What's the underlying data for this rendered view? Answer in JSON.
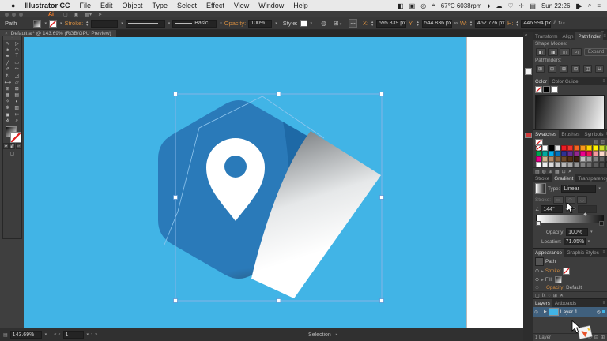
{
  "menubar": {
    "apple": "●",
    "app_name": "Illustrator CC",
    "items": [
      {
        "label": "File",
        "name": "menu-file"
      },
      {
        "label": "Edit",
        "name": "menu-edit"
      },
      {
        "label": "Object",
        "name": "menu-object"
      },
      {
        "label": "Type",
        "name": "menu-type"
      },
      {
        "label": "Select",
        "name": "menu-select"
      },
      {
        "label": "Effect",
        "name": "menu-effect"
      },
      {
        "label": "View",
        "name": "menu-view"
      },
      {
        "label": "Window",
        "name": "menu-window"
      },
      {
        "label": "Help",
        "name": "menu-help"
      }
    ],
    "status_icons": [
      {
        "glyph": "◧",
        "name": "shield-icon"
      },
      {
        "glyph": "▣",
        "name": "screen-capture-icon"
      },
      {
        "glyph": "◎",
        "name": "disk-monitor-icon"
      },
      {
        "glyph": "⌖",
        "name": "location-icon"
      },
      {
        "glyph": "67°C 6038rpm",
        "name": "temp-fan-readout"
      },
      {
        "glyph": "♦",
        "name": "ink-level-icon"
      },
      {
        "glyph": "☁",
        "name": "cloud-icon"
      },
      {
        "glyph": "♡",
        "name": "health-icon"
      },
      {
        "glyph": "✈",
        "name": "airplane-icon"
      },
      {
        "glyph": "▤",
        "name": "window-manager-icon"
      },
      {
        "glyph": "Sun 22:26",
        "name": "clock"
      },
      {
        "glyph": "▮▸",
        "name": "battery-icon"
      },
      {
        "glyph": "⌕",
        "name": "spotlight-icon"
      },
      {
        "glyph": "≡",
        "name": "control-center-icon"
      }
    ]
  },
  "header": {
    "logo": "Ai",
    "icons": [
      {
        "glyph": "▢",
        "name": "bridge-icon"
      },
      {
        "glyph": "▣",
        "name": "stock-icon"
      },
      {
        "glyph": "▦▾",
        "name": "arrange-documents-icon"
      },
      {
        "glyph": "➤",
        "name": "share-icon"
      }
    ]
  },
  "controlbar": {
    "selection_type": "Path",
    "stroke_label": "Stroke:",
    "brush_label": "Basic",
    "opacity_label": "Opacity:",
    "opacity_value": "100%",
    "style_label": "Style:",
    "x_label": "X:",
    "x_value": "595.839 px",
    "y_label": "Y:",
    "y_value": "544.836 px",
    "w_label": "W:",
    "w_value": "452.726 px",
    "h_label": "H:",
    "h_value": "446.994 px"
  },
  "doctab": {
    "close": "×",
    "title": "Default.ai* @ 143.69% (RGB/GPU Preview)"
  },
  "toolbar": {
    "tools": [
      {
        "glyph": "↖",
        "name": "selection-tool"
      },
      {
        "glyph": "▷",
        "name": "direct-selection-tool"
      },
      {
        "glyph": "✶",
        "name": "magic-wand-tool"
      },
      {
        "glyph": "◠",
        "name": "lasso-tool"
      },
      {
        "glyph": "✒",
        "name": "pen-tool"
      },
      {
        "glyph": "T",
        "name": "type-tool"
      },
      {
        "glyph": "╱",
        "name": "line-segment-tool"
      },
      {
        "glyph": "▭",
        "name": "rectangle-tool"
      },
      {
        "glyph": "✐",
        "name": "paintbrush-tool"
      },
      {
        "glyph": "✏",
        "name": "pencil-tool"
      },
      {
        "glyph": "↻",
        "name": "rotate-tool"
      },
      {
        "glyph": "◿",
        "name": "scale-tool"
      },
      {
        "glyph": "⟷",
        "name": "width-tool"
      },
      {
        "glyph": "▱",
        "name": "free-transform-tool"
      },
      {
        "glyph": "⊞",
        "name": "shape-builder-tool"
      },
      {
        "glyph": "⊠",
        "name": "perspective-grid-tool"
      },
      {
        "glyph": "▦",
        "name": "mesh-tool"
      },
      {
        "glyph": "▤",
        "name": "gradient-tool"
      },
      {
        "glyph": "✧",
        "name": "eyedropper-tool"
      },
      {
        "glyph": "◐",
        "name": "blend-tool"
      },
      {
        "glyph": "❋",
        "name": "symbol-sprayer-tool"
      },
      {
        "glyph": "▥",
        "name": "column-graph-tool"
      },
      {
        "glyph": "▣",
        "name": "artboard-tool"
      },
      {
        "glyph": "✄",
        "name": "slice-tool"
      },
      {
        "glyph": "✜",
        "name": "hand-tool"
      },
      {
        "glyph": "⌕",
        "name": "zoom-tool"
      }
    ],
    "draw_modes": [
      {
        "glyph": "▰",
        "name": "draw-normal-mode"
      },
      {
        "glyph": "▞",
        "name": "draw-behind-mode"
      },
      {
        "glyph": "▱",
        "name": "draw-inside-mode"
      }
    ],
    "screen_mode_glyph": "▢"
  },
  "panels": {
    "pathfinder": {
      "tabs": [
        "Transform",
        "Align",
        "Pathfinder"
      ],
      "shape_modes_label": "Shape Modes:",
      "expand_label": "Expand",
      "pathfinders_label": "Pathfinders:",
      "shape_modes": [
        {
          "glyph": "◧",
          "name": "unite-button"
        },
        {
          "glyph": "◨",
          "name": "minus-front-button"
        },
        {
          "glyph": "◫",
          "name": "intersect-button"
        },
        {
          "glyph": "◰",
          "name": "exclude-button"
        }
      ],
      "pathfinders": [
        {
          "glyph": "⊞",
          "name": "divide-button"
        },
        {
          "glyph": "⊟",
          "name": "trim-button"
        },
        {
          "glyph": "⊠",
          "name": "merge-button"
        },
        {
          "glyph": "⊡",
          "name": "crop-button"
        },
        {
          "glyph": "◫",
          "name": "outline-button"
        },
        {
          "glyph": "⊔",
          "name": "minus-back-button"
        }
      ]
    },
    "color": {
      "tabs": [
        "Color",
        "Color Guide"
      ]
    },
    "swatches": {
      "tabs": [
        "Swatches",
        "Brushes",
        "Symbols"
      ],
      "rows": [
        [
          "none",
          "#ffffff",
          "#000000",
          "#e8e8e8",
          "#ed1c24",
          "#f0342c",
          "#f26522",
          "#f8981d",
          "#ffd400",
          "#fff200",
          "#cadb2a",
          "#8dc63f",
          "#39b54a",
          "#b06e28"
        ],
        [
          "#00a651",
          "#00a99d",
          "#00aeef",
          "#0072bc",
          "#2e3192",
          "#662d91",
          "#92278f",
          "#ec008c",
          "#ed1458",
          "#f5989d",
          "#fbd7c9",
          "#c7b299",
          "#8c6239",
          "#603913"
        ],
        [
          "#ec008c",
          "#d2b48c",
          "#b08968",
          "#8a6642",
          "#6e4a2a",
          "#543214",
          "#3b2210",
          "#c0c0c0",
          "#a0a0a0",
          "#808080",
          "#606060",
          "#404040",
          "#202020",
          "#000000"
        ],
        [
          "#ffffff",
          "#ededed",
          "#dbdbdb",
          "#c9c9c9",
          "#b7b7b7",
          "#a5a5a5",
          "#939393",
          "#818181",
          "#6f6f6f",
          "#5d5d5d",
          "#4b4b4b",
          "#393939",
          "#272727",
          "#151515"
        ]
      ],
      "footer_icons": [
        {
          "glyph": "▤",
          "name": "swatch-libraries-icon"
        },
        {
          "glyph": "◍",
          "name": "color-themes-icon"
        },
        {
          "glyph": "⊕",
          "name": "add-selected-icon"
        },
        {
          "glyph": "▦",
          "name": "show-kinds-icon"
        },
        {
          "glyph": "⊡",
          "name": "new-group-icon"
        },
        {
          "glyph": "✕",
          "name": "delete-swatch-icon"
        }
      ]
    },
    "gradient": {
      "tabs": [
        "Stroke",
        "Gradient",
        "Transparency"
      ],
      "type_label": "Type:",
      "type_value": "Linear",
      "stroke_label": "Stroke:",
      "stroke_buttons": [
        {
          "glyph": "▭",
          "name": "stroke-within-button"
        },
        {
          "glyph": "◠",
          "name": "stroke-along-button"
        },
        {
          "glyph": "◡",
          "name": "stroke-across-button"
        }
      ],
      "angle_value": "144°",
      "opacity_label": "Opacity:",
      "opacity_value": "100%",
      "location_label": "Location:",
      "location_value": "71.05%"
    },
    "appearance": {
      "tabs": [
        "Appearance",
        "Graphic Styles"
      ],
      "object": "Path",
      "stroke_label": "Stroke:",
      "fill_label": "Fill:",
      "opacity_label": "Opacity:",
      "opacity_value": "Default",
      "footer_icons": [
        {
          "glyph": "▢",
          "name": "new-stroke-icon"
        },
        {
          "glyph": "fx",
          "name": "effects-icon"
        },
        {
          "glyph": "◌",
          "name": "clear-appearance-icon"
        },
        {
          "glyph": "⊞",
          "name": "duplicate-item-icon"
        },
        {
          "glyph": "✕",
          "name": "delete-item-icon"
        }
      ]
    },
    "layers": {
      "tabs": [
        "Layers",
        "Artboards"
      ],
      "name": "Layer 1",
      "footer": "1 Layer",
      "footer_icons": [
        {
          "glyph": "⌕",
          "name": "locate-object-icon"
        },
        {
          "glyph": "▱",
          "name": "make-mask-icon"
        },
        {
          "glyph": "⊟",
          "name": "new-sublayer-icon"
        },
        {
          "glyph": "⊞",
          "name": "new-layer-icon"
        }
      ]
    }
  },
  "statusbar": {
    "zoom": "143.69%",
    "artboard_value": "1",
    "status": "Selection"
  },
  "artwork": {
    "colors": {
      "artboard_blue": "#41b4e6",
      "hexagon_blue": "#2a7ab9",
      "hexagon_dark": "#1e69a6",
      "fold_gray": "#84888b",
      "fold_white": "#ffffff",
      "pin_white": "#ffffff",
      "selection_blue": "#85b5e6"
    }
  }
}
